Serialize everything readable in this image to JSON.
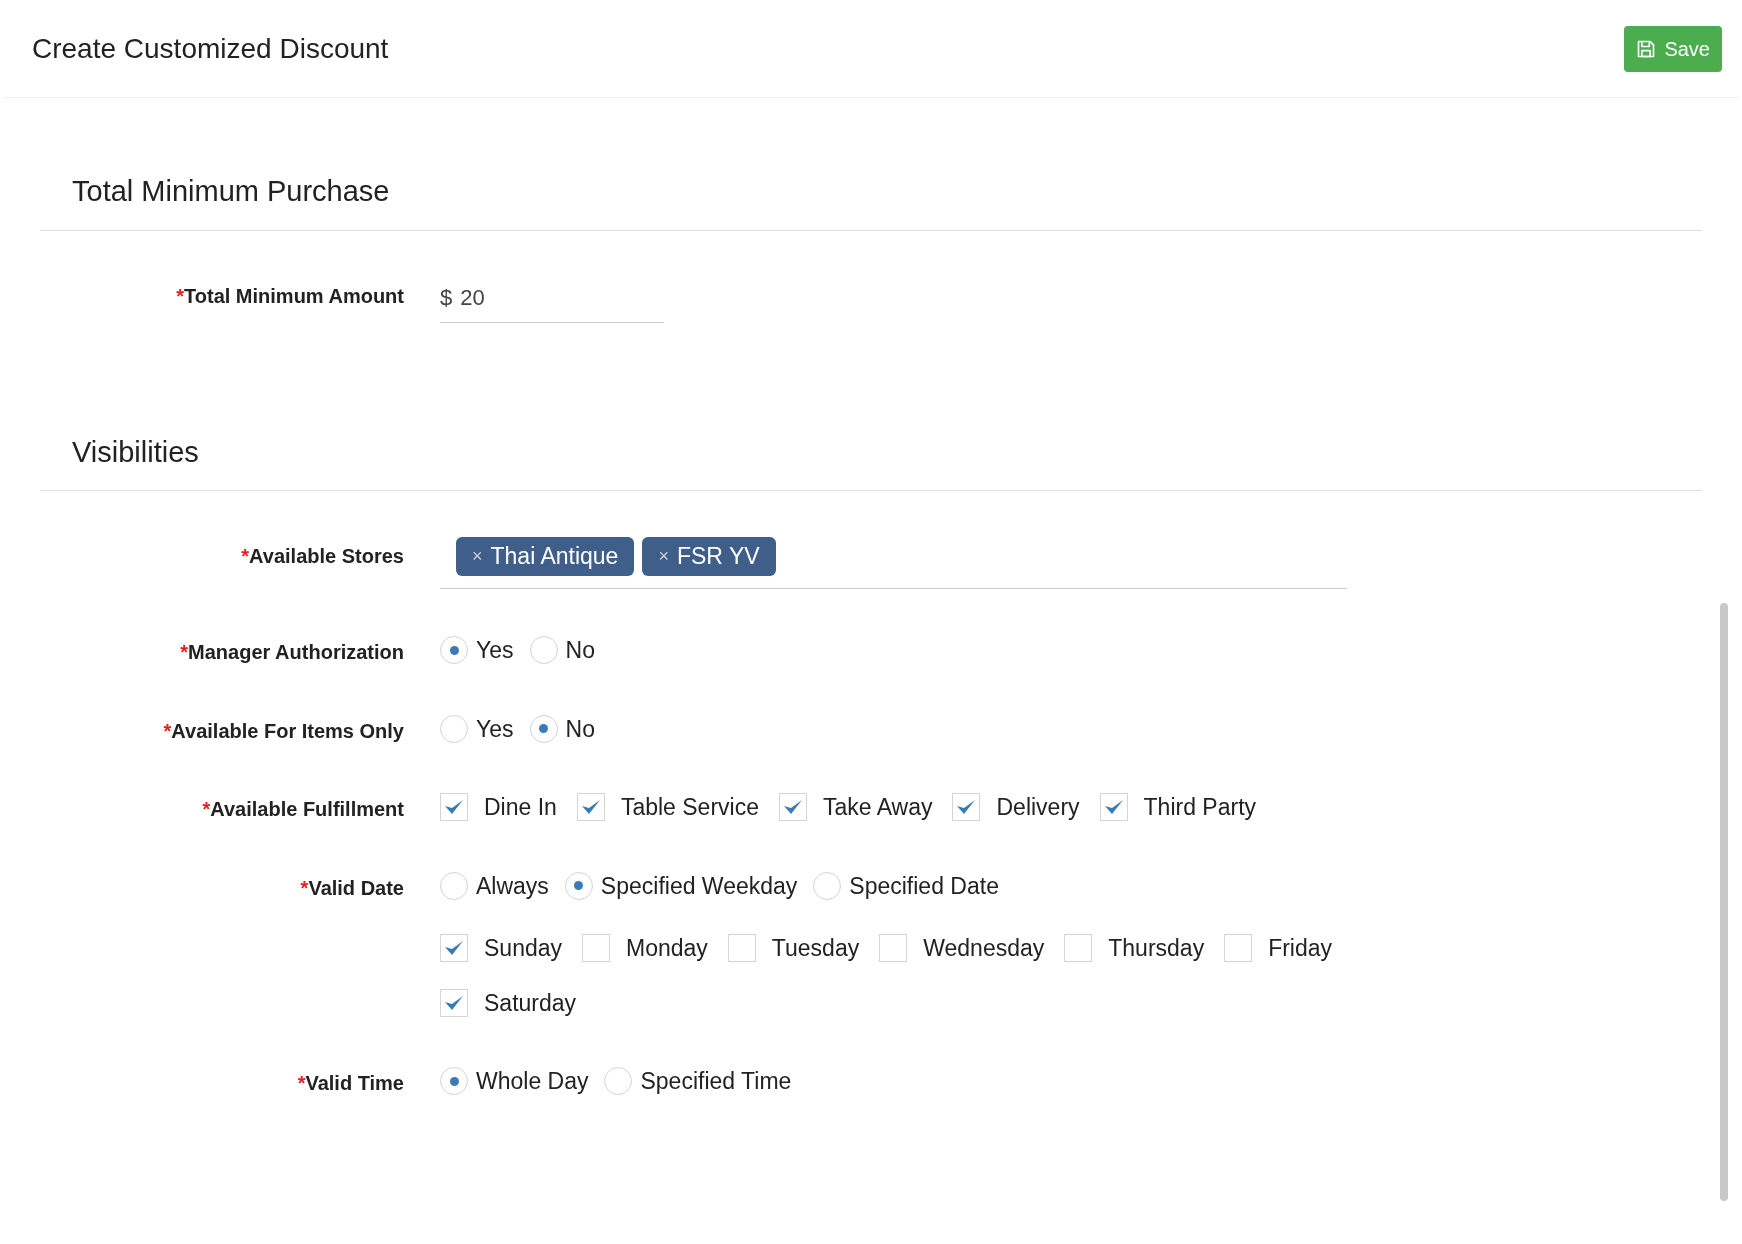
{
  "header": {
    "title": "Create Customized Discount",
    "save_button": "Save"
  },
  "sections": [
    {
      "title": "Total Minimum Purchase",
      "fields": [
        {
          "kind": "input",
          "label": "Total Minimum Amount",
          "required_mark": "*",
          "prefix": "$",
          "value": "20"
        }
      ]
    },
    {
      "title": "Visibilities",
      "fields": [
        {
          "kind": "tags",
          "label": "Available Stores",
          "required_mark": "*",
          "tags": [
            {
              "label": "Thai Antique",
              "remove": "×"
            },
            {
              "label": "FSR YV",
              "remove": "×"
            }
          ]
        },
        {
          "kind": "radio",
          "label": "Manager Authorization",
          "required_mark": "*",
          "options": [
            {
              "label": "Yes",
              "selected": true
            },
            {
              "label": "No",
              "selected": false
            }
          ]
        },
        {
          "kind": "radio",
          "label": "Available For Items Only",
          "required_mark": "*",
          "options": [
            {
              "label": "Yes",
              "selected": false
            },
            {
              "label": "No",
              "selected": true
            }
          ]
        },
        {
          "kind": "checkbox",
          "label": "Available Fulfillment",
          "required_mark": "*",
          "options": [
            {
              "label": "Dine In",
              "checked": true
            },
            {
              "label": "Table Service",
              "checked": true
            },
            {
              "label": "Take Away",
              "checked": true
            },
            {
              "label": "Delivery",
              "checked": true
            },
            {
              "label": "Third Party",
              "checked": true
            }
          ]
        },
        {
          "kind": "radio",
          "label": "Valid Date",
          "required_mark": "*",
          "options": [
            {
              "label": "Always",
              "selected": false
            },
            {
              "label": "Specified Weekday",
              "selected": true
            },
            {
              "label": "Specified Date",
              "selected": false
            }
          ],
          "sub_options": [
            {
              "label": "Sunday",
              "checked": true
            },
            {
              "label": "Monday",
              "checked": false
            },
            {
              "label": "Tuesday",
              "checked": false
            },
            {
              "label": "Wednesday",
              "checked": false
            },
            {
              "label": "Thursday",
              "checked": false
            },
            {
              "label": "Friday",
              "checked": false
            },
            {
              "label": "Saturday",
              "checked": true
            }
          ]
        },
        {
          "kind": "radio",
          "label": "Valid Time",
          "required_mark": "*",
          "options": [
            {
              "label": "Whole Day",
              "selected": true
            },
            {
              "label": "Specified Time",
              "selected": false
            }
          ]
        }
      ]
    }
  ]
}
